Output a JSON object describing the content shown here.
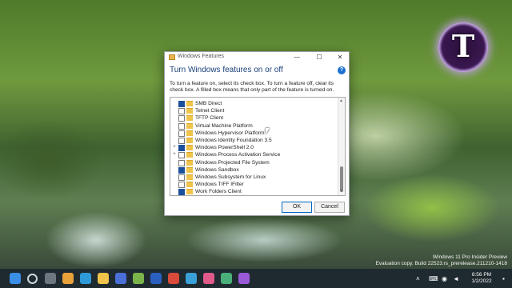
{
  "dialog": {
    "window_title": "Windows Features",
    "heading": "Turn Windows features on or off",
    "help_label": "?",
    "description": "To turn a feature on, select its check box. To turn a feature off, clear its check box. A filled box means that only part of the feature is turned on.",
    "minimize": "—",
    "maximize": "☐",
    "close": "✕",
    "ok_label": "OK",
    "cancel_label": "Cancel",
    "features": [
      {
        "label": "SMB Direct",
        "checked": true,
        "expandable": false
      },
      {
        "label": "Telnet Client",
        "checked": false,
        "expandable": false
      },
      {
        "label": "TFTP Client",
        "checked": false,
        "expandable": false
      },
      {
        "label": "Virtual Machine Platform",
        "checked": false,
        "expandable": false
      },
      {
        "label": "Windows Hypervisor Platform",
        "checked": false,
        "expandable": false
      },
      {
        "label": "Windows Identity Foundation 3.5",
        "checked": false,
        "expandable": false
      },
      {
        "label": "Windows PowerShell 2.0",
        "checked": true,
        "expandable": true
      },
      {
        "label": "Windows Process Activation Service",
        "checked": false,
        "expandable": true
      },
      {
        "label": "Windows Projected File System",
        "checked": false,
        "expandable": false
      },
      {
        "label": "Windows Sandbox",
        "checked": true,
        "expandable": false
      },
      {
        "label": "Windows Subsystem for Linux",
        "checked": false,
        "expandable": false
      },
      {
        "label": "Windows TIFF IFilter",
        "checked": false,
        "expandable": false
      },
      {
        "label": "Work Folders Client",
        "checked": true,
        "expandable": false
      }
    ]
  },
  "desktop": {
    "logo_letter": "T",
    "watermark_line1": "Windows 11 Pro Insider Preview",
    "watermark_line2": "Evaluation copy. Build 22523.rs_prerelease.211210-1418"
  },
  "taskbar": {
    "time": "8:56 PM",
    "date": "1/2/2022",
    "icons": [
      "start-icon",
      "search-icon",
      "task-view-icon",
      "chrome-icon",
      "edge-icon",
      "explorer-icon",
      "store-icon",
      "app-icon",
      "word-icon",
      "app-icon",
      "app-icon",
      "app-icon",
      "app-icon",
      "app-icon"
    ]
  },
  "colors": {
    "accent": "#0067c0",
    "heading": "#1a3f7a",
    "taskbar": "#1f2a30"
  }
}
